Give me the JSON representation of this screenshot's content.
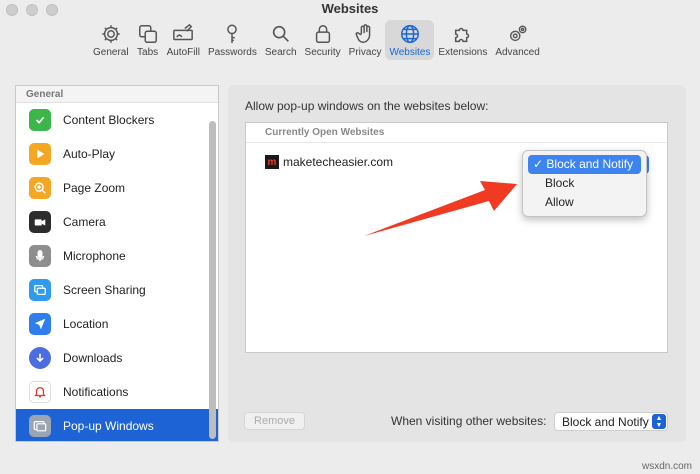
{
  "window": {
    "title": "Websites"
  },
  "tabs": [
    {
      "label": "General",
      "icon": "gear-icon"
    },
    {
      "label": "Tabs",
      "icon": "tabs-icon"
    },
    {
      "label": "AutoFill",
      "icon": "autofill-icon"
    },
    {
      "label": "Passwords",
      "icon": "key-icon"
    },
    {
      "label": "Search",
      "icon": "search-icon"
    },
    {
      "label": "Security",
      "icon": "lock-icon"
    },
    {
      "label": "Privacy",
      "icon": "hand-icon"
    },
    {
      "label": "Websites",
      "icon": "globe-icon",
      "active": true
    },
    {
      "label": "Extensions",
      "icon": "puzzle-icon"
    },
    {
      "label": "Advanced",
      "icon": "gears-icon"
    }
  ],
  "sidebar": {
    "header": "General",
    "items": [
      {
        "label": "Content Blockers",
        "icon": "shield-check-icon",
        "color": "#3cb54a"
      },
      {
        "label": "Auto-Play",
        "icon": "play-icon",
        "color": "#f5a623"
      },
      {
        "label": "Page Zoom",
        "icon": "zoom-icon",
        "color": "#f5a623"
      },
      {
        "label": "Camera",
        "icon": "camera-icon",
        "color": "#2d2d2d"
      },
      {
        "label": "Microphone",
        "icon": "microphone-icon",
        "color": "#8e8e8e"
      },
      {
        "label": "Screen Sharing",
        "icon": "screen-sharing-icon",
        "color": "#2f9bf0"
      },
      {
        "label": "Location",
        "icon": "location-icon",
        "color": "#2f7ef0"
      },
      {
        "label": "Downloads",
        "icon": "download-icon",
        "color": "#4a6ee0"
      },
      {
        "label": "Notifications",
        "icon": "bell-icon",
        "color": "#ffffff"
      },
      {
        "label": "Pop-up Windows",
        "icon": "popup-window-icon",
        "color": "#9aa4b2",
        "selected": true
      }
    ]
  },
  "main": {
    "label": "Allow pop-up windows on the websites below:",
    "list_header": "Currently Open Websites",
    "sites": [
      {
        "favicon": "m",
        "domain": "maketecheasier.com",
        "setting": "Block and Notify"
      }
    ],
    "remove_label": "Remove",
    "other_label": "When visiting other websites:",
    "other_value": "Block and Notify"
  },
  "menu": {
    "options": [
      "Block and Notify",
      "Block",
      "Allow"
    ],
    "selected": "Block and Notify",
    "check": "✓"
  },
  "colors": {
    "accent": "#1e63d6",
    "arrow": "#f03a22"
  },
  "watermark": "wsxdn.com"
}
